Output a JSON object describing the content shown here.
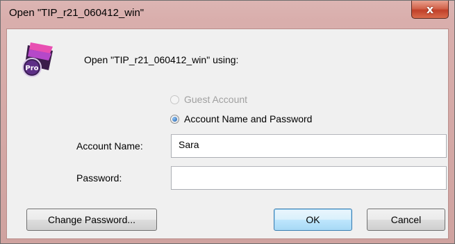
{
  "window": {
    "title": "Open \"TIP_r21_060412_win\"",
    "close_label": "x"
  },
  "prompt": "Open \"TIP_r21_060412_win\" using:",
  "options": {
    "guest": {
      "label": "Guest Account",
      "enabled": false,
      "selected": false
    },
    "account": {
      "label": "Account Name and Password",
      "enabled": true,
      "selected": true
    }
  },
  "fields": {
    "account_name": {
      "label": "Account Name:",
      "value": "Sara"
    },
    "password": {
      "label": "Password:",
      "value": ""
    }
  },
  "buttons": {
    "change_password": "Change Password...",
    "ok": "OK",
    "cancel": "Cancel"
  },
  "icon": {
    "name": "filemaker-pro-icon",
    "badge": "Pro"
  }
}
